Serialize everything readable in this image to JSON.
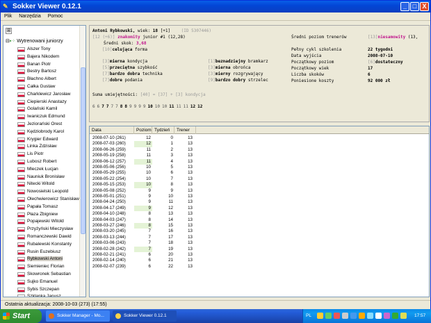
{
  "window": {
    "title": "Sokker Viewer 0.12.1",
    "min": "_",
    "max": "□",
    "close": "X"
  },
  "menu": [
    "Plik",
    "Narzędzia",
    "Pomoc"
  ],
  "tree": {
    "toolbar_icon": "⊞",
    "root_label": "Wytrenowani juniorzy",
    "items": [
      "Alszer Tony",
      "Bajera Nikodem",
      "Banan Piotr",
      "Bestry Bartosz",
      "Błachno Albert",
      "Całka Gustaw",
      "Charklewicz Jarosław",
      "Ciepierski Anastazy",
      "Golański Kamil",
      "Iwaniczuk Edmund",
      "Jeziorański Orest",
      "Kędziobrody Karol",
      "Krygier Edward",
      "Linka Zdzisław",
      "Lis Piotr",
      "Lubosz Robert",
      "Mleczek Łucjan",
      "Nauniuk Bronisław",
      "Nitecki Witold",
      "Nowosielski Leopold",
      "Olechwierowicz Stanisław",
      "Papała Tomasz",
      "Płaza Zbigniew",
      "Popajewski Witold",
      "Przyżyński Mieczysław",
      "Romanczewski Dawid",
      "Rubalewski Konstanty",
      "Rusin Euzebiusz",
      "Rybkowski Antoni",
      "Siemieniec Florian",
      "Skowronek Sebastian",
      "Sujko Emanuel",
      "Sybis Szczepan",
      "Szklanka Janusz",
      "Szlefer Fryk"
    ],
    "selected_index": 28
  },
  "player": {
    "name": "Antoni Rybkowski,",
    "age_label": "wiek:",
    "age": "18",
    "age_delta": "[+1]",
    "id": "(ID 5307446)",
    "junior_prefix": "[12 (+6)]",
    "junior_level": "znakomity",
    "junior_suffix": "junior #1 (12,28)",
    "avg_jump_label": "Średni skok:",
    "avg_jump": "3,68",
    "form_num": "[10]",
    "form_word": "celująca",
    "form_text": "forma",
    "coach_label": "Średni poziom trenerów",
    "coach_num": "[13]",
    "coach_word": "niesamowity",
    "coach_extra": "(13,",
    "stats_left": [
      {
        "num": "[3]",
        "word": "mierna",
        "text": "kondycja"
      },
      {
        "num": "[5]",
        "word": "przeciętna",
        "text": "szybkość"
      },
      {
        "num": "[7]",
        "word": "bardzo dobra",
        "text": "technika"
      },
      {
        "num": "[7]",
        "word": "dobre",
        "text": "podania"
      }
    ],
    "stats_mid": [
      {
        "num": "[1]",
        "word": "beznadziejny",
        "text": "bramkarz"
      },
      {
        "num": "[3]",
        "word": "mierna",
        "text": "obrońca"
      },
      {
        "num": "[3]",
        "word": "mierny",
        "text": "rozgrywający"
      },
      {
        "num": "[9]",
        "word": "bardzo dobry",
        "text": "strzelec"
      }
    ],
    "stats_right": [
      {
        "label": "Pełny cykl szkolenia",
        "value": "22 tygodni"
      },
      {
        "label": "Data wyjścia",
        "value": "2008-07-10"
      },
      {
        "label": "Początkowy poziom",
        "value": "dostateczny",
        "prefix": "[6]"
      },
      {
        "label": "Początkowy wiek",
        "value": "17"
      },
      {
        "label": "Liczba skoków",
        "value": "6"
      },
      {
        "label": "Poniesione koszty",
        "value": "92 000 zł"
      }
    ],
    "sum_label": "Suma umiejętności:",
    "sum_value": "[40] = [37] + [3] kondycja",
    "progression": [
      "6",
      "6",
      "7",
      "7",
      "7",
      "7",
      "8",
      "8",
      "9",
      "9",
      "9",
      "9",
      "10",
      "10",
      "10",
      "11",
      "11",
      "11",
      "12",
      "12"
    ],
    "progression_bold": [
      2,
      3,
      6,
      7,
      12,
      15,
      18,
      19
    ]
  },
  "table": {
    "headers": [
      "Data",
      "Poziom",
      "Tydzień",
      "Trener"
    ],
    "rows": [
      [
        "2008-07-10 (261)",
        "12",
        "0",
        "13",
        false
      ],
      [
        "2008-07-03 (260)",
        "12",
        "1",
        "13",
        true
      ],
      [
        "2008-06-26 (259)",
        "11",
        "2",
        "13",
        false
      ],
      [
        "2008-05-19 (258)",
        "11",
        "3",
        "13",
        false
      ],
      [
        "2008-06-12 (257)",
        "11",
        "4",
        "13",
        true
      ],
      [
        "2008-05-06 (256)",
        "10",
        "5",
        "13",
        false
      ],
      [
        "2008-05-29 (255)",
        "10",
        "6",
        "13",
        false
      ],
      [
        "2008-05-22 (254)",
        "10",
        "7",
        "13",
        false
      ],
      [
        "2008-05-15 (253)",
        "10",
        "8",
        "13",
        true
      ],
      [
        "2008-05-08 (252)",
        "9",
        "9",
        "13",
        false
      ],
      [
        "2008-05-01 (251)",
        "9",
        "10",
        "13",
        false
      ],
      [
        "2008-04-24 (250)",
        "9",
        "11",
        "13",
        false
      ],
      [
        "2008-04-17 (249)",
        "9",
        "12",
        "13",
        true
      ],
      [
        "2008-04-10 (248)",
        "8",
        "13",
        "13",
        false
      ],
      [
        "2008-04-03 (247)",
        "8",
        "14",
        "13",
        false
      ],
      [
        "2008-03-27 (246)",
        "8",
        "15",
        "13",
        true
      ],
      [
        "2008-03-20 (245)",
        "7",
        "16",
        "13",
        false
      ],
      [
        "2008-03-13 (244)",
        "7",
        "17",
        "13",
        false
      ],
      [
        "2008-03-06 (243)",
        "7",
        "18",
        "13",
        false
      ],
      [
        "2008-02-28 (242)",
        "7",
        "19",
        "13",
        true
      ],
      [
        "2008-02-21 (241)",
        "6",
        "20",
        "13",
        false
      ],
      [
        "2008-02-14 (240)",
        "6",
        "21",
        "13",
        false
      ],
      [
        "2008-02-07 (239)",
        "6",
        "22",
        "13",
        false
      ]
    ]
  },
  "status": "Ostatnia aktualizacja: 2008-10-03 (273) (17:55)",
  "taskbar": {
    "start": "Start",
    "tasks": [
      "Sokker Manager - Mo...",
      "Sokker Viewer 0.12.1"
    ],
    "lang": "PL",
    "clock": "17:57"
  }
}
